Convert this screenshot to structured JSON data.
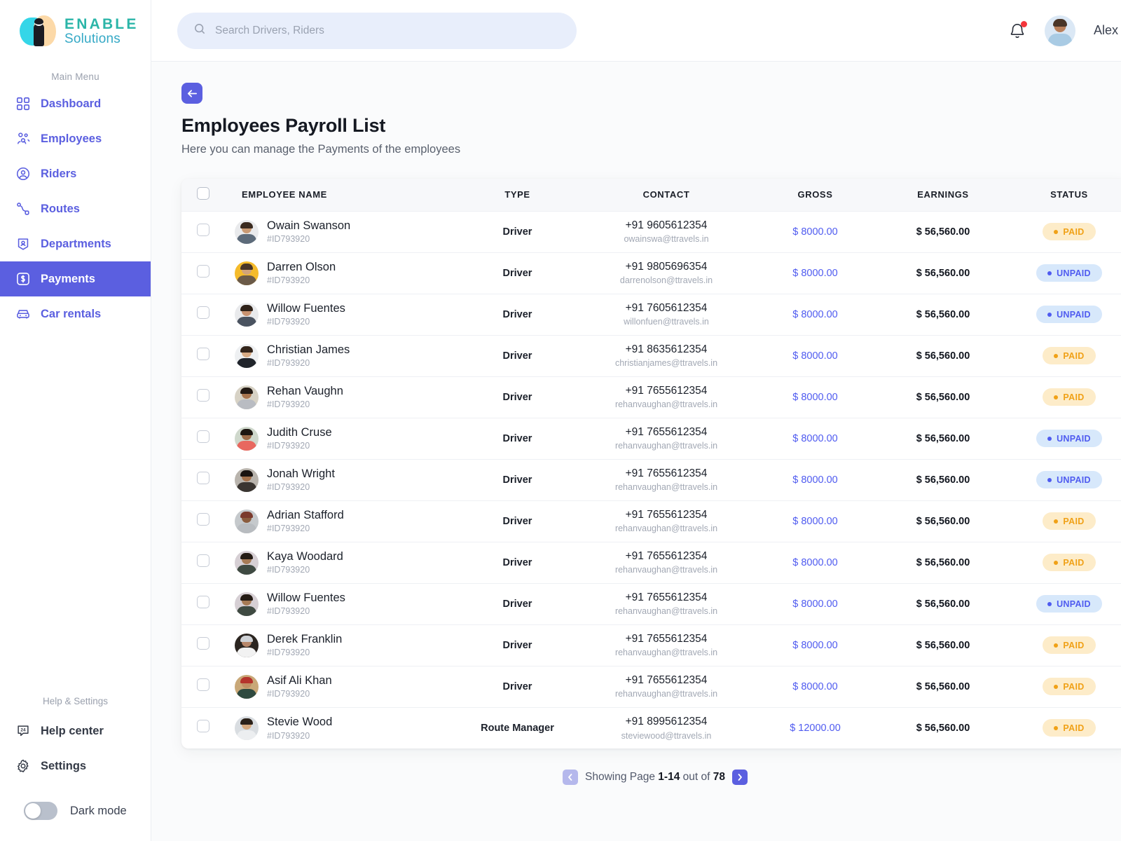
{
  "brand": {
    "title": "ENABLE",
    "subtitle": "Solutions"
  },
  "sidebar": {
    "main_label": "Main Menu",
    "items": [
      {
        "label": "Dashboard",
        "icon": "grid-icon",
        "active": false
      },
      {
        "label": "Employees",
        "icon": "people-icon",
        "active": false
      },
      {
        "label": "Riders",
        "icon": "user-circle-icon",
        "active": false
      },
      {
        "label": "Routes",
        "icon": "route-icon",
        "active": false
      },
      {
        "label": "Departments",
        "icon": "badge-id-icon",
        "active": false
      },
      {
        "label": "Payments",
        "icon": "dollar-square-icon",
        "active": true
      },
      {
        "label": "Car rentals",
        "icon": "car-icon",
        "active": false
      }
    ],
    "help_label": "Help & Settings",
    "help_items": [
      {
        "label": "Help center",
        "icon": "support-24-icon"
      },
      {
        "label": "Settings",
        "icon": "gear-icon"
      }
    ],
    "dark_mode_label": "Dark mode",
    "dark_mode_on": false
  },
  "topbar": {
    "search_placeholder": "Search Drivers, Riders",
    "search_value": "",
    "username": "Alex",
    "notification_badge": true
  },
  "page": {
    "title": "Employees Payroll List",
    "subtitle": "Here you can manage the Payments of the employees"
  },
  "table": {
    "columns": [
      "EMPLOYEE NAME",
      "TYPE",
      "CONTACT",
      "GROSS",
      "EARNINGS",
      "STATUS"
    ],
    "rows": [
      {
        "name": "Owain Swanson",
        "id": "#ID793920",
        "type": "Driver",
        "phone": "+91 9605612354",
        "email": "owainswa@ttravels.in",
        "gross": "$ 8000.00",
        "earnings": "$ 56,560.00",
        "status": "PAID",
        "avatar": {
          "skin": "#c99a74",
          "hair": "#3a2a1f",
          "shirt": "#5d6b7a",
          "bg": "#e9eaec"
        }
      },
      {
        "name": "Darren Olson",
        "id": "#ID793920",
        "type": "Driver",
        "phone": "+91 9805696354",
        "email": "darrenolson@ttravels.in",
        "gross": "$ 8000.00",
        "earnings": "$ 56,560.00",
        "status": "UNPAID",
        "avatar": {
          "skin": "#d1a37a",
          "hair": "#4a3526",
          "shirt": "#6b5a48",
          "bg": "#f5bb2b"
        }
      },
      {
        "name": "Willow Fuentes",
        "id": "#ID793920",
        "type": "Driver",
        "phone": "+91 7605612354",
        "email": "willonfuen@ttravels.in",
        "gross": "$ 8000.00",
        "earnings": "$ 56,560.00",
        "status": "UNPAID",
        "avatar": {
          "skin": "#c89270",
          "hair": "#2f2219",
          "shirt": "#4a5360",
          "bg": "#e9eaec"
        }
      },
      {
        "name": "Christian James",
        "id": "#ID793920",
        "type": "Driver",
        "phone": "+91 8635612354",
        "email": "christianjames@ttravels.in",
        "gross": "$ 8000.00",
        "earnings": "$ 56,560.00",
        "status": "PAID",
        "avatar": {
          "skin": "#d8ab85",
          "hair": "#33251b",
          "shirt": "#20242b",
          "bg": "#eef0f2"
        }
      },
      {
        "name": "Rehan Vaughn",
        "id": "#ID793920",
        "type": "Driver",
        "phone": "+91 7655612354",
        "email": "rehanvaughan@ttravels.in",
        "gross": "$ 8000.00",
        "earnings": "$ 56,560.00",
        "status": "PAID",
        "avatar": {
          "skin": "#a9764f",
          "hair": "#231a14",
          "shirt": "#b9bcc2",
          "bg": "#d7d2c5"
        }
      },
      {
        "name": "Judith Cruse",
        "id": "#ID793920",
        "type": "Driver",
        "phone": "+91 7655612354",
        "email": "rehanvaughan@ttravels.in",
        "gross": "$ 8000.00",
        "earnings": "$ 56,560.00",
        "status": "UNPAID",
        "avatar": {
          "skin": "#9d6c49",
          "hair": "#1d1611",
          "shirt": "#e8685f",
          "bg": "#cfd8cc"
        }
      },
      {
        "name": "Jonah Wright",
        "id": "#ID793920",
        "type": "Driver",
        "phone": "+91 7655612354",
        "email": "rehanvaughan@ttravels.in",
        "gross": "$ 8000.00",
        "earnings": "$ 56,560.00",
        "status": "UNPAID",
        "avatar": {
          "skin": "#a3714c",
          "hair": "#191310",
          "shirt": "#3a3531",
          "bg": "#b9b4ad"
        }
      },
      {
        "name": "Adrian Stafford",
        "id": "#ID793920",
        "type": "Driver",
        "phone": "+91 7655612354",
        "email": "rehanvaughan@ttravels.in",
        "gross": "$ 8000.00",
        "earnings": "$ 56,560.00",
        "status": "PAID",
        "avatar": {
          "skin": "#8a5c3d",
          "hair": "#7b3a2c",
          "shirt": "#b8bcc0",
          "bg": "#c5c9cc"
        }
      },
      {
        "name": "Kaya Woodard",
        "id": "#ID793920",
        "type": "Driver",
        "phone": "+91 7655612354",
        "email": "rehanvaughan@ttravels.in",
        "gross": "$ 8000.00",
        "earnings": "$ 56,560.00",
        "status": "PAID",
        "avatar": {
          "skin": "#a67a55",
          "hair": "#241b14",
          "shirt": "#3f4a42",
          "bg": "#d6cfd4"
        }
      },
      {
        "name": "Willow Fuentes",
        "id": "#ID793920",
        "type": "Driver",
        "phone": "+91 7655612354",
        "email": "rehanvaughan@ttravels.in",
        "gross": "$ 8000.00",
        "earnings": "$ 56,560.00",
        "status": "UNPAID",
        "avatar": {
          "skin": "#a67a55",
          "hair": "#241b14",
          "shirt": "#3f4a42",
          "bg": "#d6cfd4"
        }
      },
      {
        "name": "Derek Franklin",
        "id": "#ID793920",
        "type": "Driver",
        "phone": "+91 7655612354",
        "email": "rehanvaughan@ttravels.in",
        "gross": "$ 8000.00",
        "earnings": "$ 56,560.00",
        "status": "PAID",
        "avatar": {
          "skin": "#b7876a",
          "hair": "#cfd2d6",
          "shirt": "#f2f2f2",
          "bg": "#2b2520"
        }
      },
      {
        "name": "Asif Ali Khan",
        "id": "#ID793920",
        "type": "Driver",
        "phone": "+91 7655612354",
        "email": "rehanvaughan@ttravels.in",
        "gross": "$ 8000.00",
        "earnings": "$ 56,560.00",
        "status": "PAID",
        "avatar": {
          "skin": "#c08f63",
          "hair": "#b5342c",
          "shirt": "#2f4a3f",
          "bg": "#c9a878"
        }
      },
      {
        "name": "Stevie Wood",
        "id": "#ID793920",
        "type": "Route Manager",
        "phone": "+91 8995612354",
        "email": "steviewood@ttravels.in",
        "gross": "$ 12000.00",
        "earnings": "$ 56,560.00",
        "status": "PAID",
        "avatar": {
          "skin": "#d6a97f",
          "hair": "#2b2119",
          "shirt": "#eceef0",
          "bg": "#d9dde1"
        }
      }
    ]
  },
  "pagination": {
    "prefix": "Showing Page",
    "range": "1-14",
    "middle": "out of",
    "total": "78",
    "prev_icon": "chevron-left-icon",
    "next_icon": "chevron-right-icon"
  },
  "colors": {
    "accent": "#5b5fe0",
    "paid_bg": "#fdecc9",
    "paid_fg": "#f0a117",
    "unpaid_bg": "#d7e8fb",
    "unpaid_fg": "#4f5bf0",
    "brand_teal": "#2bb5a8"
  }
}
